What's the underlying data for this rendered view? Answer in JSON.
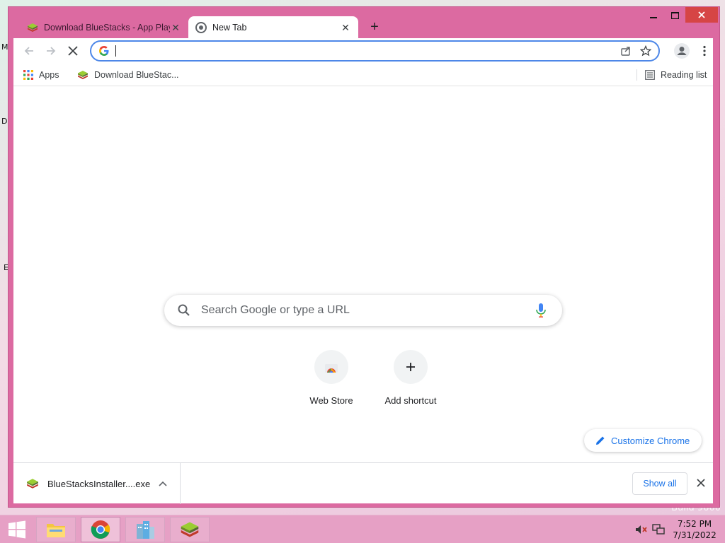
{
  "desktop": {
    "edge_labels": [
      "M",
      "D",
      "E"
    ],
    "watermark": "Build 9600"
  },
  "window": {
    "tabs": [
      {
        "title": "Download BlueStacks - App Player",
        "icon": "bluestacks-icon",
        "active": false
      },
      {
        "title": "New Tab",
        "icon": "chrome-icon",
        "active": true
      }
    ],
    "controls": {
      "minimize": "minimize-icon",
      "maximize": "maximize-icon",
      "close": "close-icon"
    }
  },
  "toolbar": {
    "back_icon": "back-arrow-icon",
    "forward_icon": "forward-arrow-icon",
    "stop_icon": "stop-loading-icon",
    "address_value": "",
    "share_icon": "share-icon",
    "bookmark_icon": "star-icon",
    "profile_icon": "profile-icon",
    "menu_icon": "kebab-menu-icon"
  },
  "bookmarks": {
    "apps_label": "Apps",
    "items": [
      {
        "label": "Download BlueStac...",
        "icon": "bluestacks-icon"
      }
    ],
    "reading_list_label": "Reading list"
  },
  "ntp": {
    "search_placeholder": "Search Google or type a URL",
    "shortcuts": [
      {
        "label": "Web Store",
        "icon": "chrome-web-store-icon"
      },
      {
        "label": "Add shortcut",
        "icon": "plus-icon"
      }
    ],
    "customize_label": "Customize Chrome"
  },
  "downloads": {
    "file_name": "BlueStacksInstaller....exe",
    "show_all_label": "Show all"
  },
  "taskbar": {
    "apps": [
      "file-explorer-icon",
      "chrome-icon",
      "office-buildings-icon",
      "bluestacks-icon"
    ],
    "time": "7:52 PM",
    "date": "7/31/2022"
  },
  "colors": {
    "window_frame": "#dc6aa1",
    "taskbar": "#e6a0c5",
    "omnibox_focus": "#4d87e8",
    "link_blue": "#1a73e8"
  }
}
